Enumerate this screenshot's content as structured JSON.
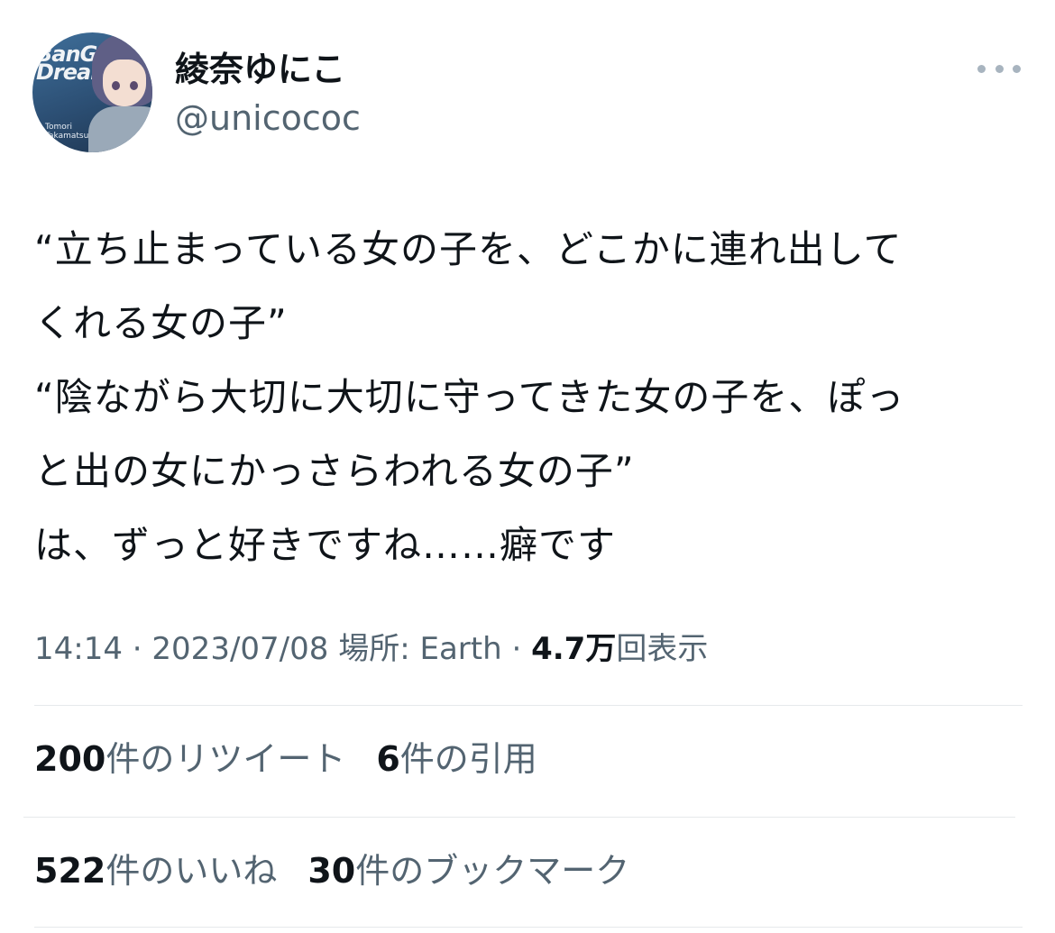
{
  "author": {
    "display_name": "綾奈ゆにこ",
    "handle": "@unicococ",
    "avatar_logo_text": "BanG Dream!",
    "avatar_caption": "Tomori Takamatsu"
  },
  "tweet": {
    "text": "“立ち止まっている女の子を、どこかに連れ出して\nくれる女の子”\n“陰ながら大切に大切に守ってきた女の子を、ぽっ\nと出の女にかっさらわれる女の子”\nは、ずっと好きですね……癖です"
  },
  "meta": {
    "time": "14:14",
    "separator": "·",
    "date": "2023/07/08",
    "location": "場所: Earth",
    "views_count": "4.7万",
    "views_label": "回表示"
  },
  "stats": {
    "retweets_count": "200",
    "retweets_label": "件のリツイート",
    "quotes_count": "6",
    "quotes_label": "件の引用",
    "likes_count": "522",
    "likes_label": "件のいいね",
    "bookmarks_count": "30",
    "bookmarks_label": "件のブックマーク"
  },
  "icons": {
    "more": "more-horizontal-icon"
  },
  "colors": {
    "text_primary": "#0f1419",
    "text_secondary": "#536471",
    "divider": "#e6e9eb"
  }
}
